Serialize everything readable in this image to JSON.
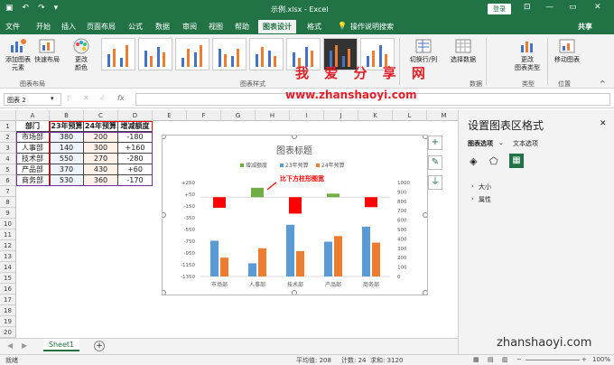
{
  "window": {
    "title": "示例.xlsx  -  Excel",
    "login_label": "登录",
    "share_label": "共享",
    "minimize": "—",
    "restore": "▭",
    "close": "✕"
  },
  "tabs": [
    "文件",
    "开始",
    "插入",
    "页面布局",
    "公式",
    "数据",
    "审阅",
    "视图",
    "帮助",
    "图表设计",
    "格式",
    "操作说明搜索"
  ],
  "ribbon": {
    "add_element": "添加图表\n元素",
    "quick_layout": "快速布局",
    "change_colors": "更改\n颜色",
    "switch_rowcol": "切换行/列",
    "select_data": "选择数据",
    "change_type": "更改\n图表类型",
    "move_chart": "移动图表",
    "groups": {
      "layout": "图表布局",
      "styles": "图表样式",
      "data": "数据",
      "type": "类型",
      "location": "位置"
    }
  },
  "watermark": {
    "site_cn": "我 爱 分 享 网",
    "url": "www.zhanshaoyi.com",
    "bottom_url": "zhanshaoyi.com"
  },
  "namebox": "图表 2",
  "fx": "fx",
  "columns": [
    "A",
    "B",
    "C",
    "D",
    "E",
    "F",
    "G",
    "H",
    "I",
    "J",
    "K",
    "L",
    "M"
  ],
  "rows": [
    "1",
    "2",
    "3",
    "4",
    "5",
    "6",
    "7",
    "8",
    "9",
    "10",
    "11",
    "12",
    "13",
    "14",
    "15",
    "16",
    "17",
    "18",
    "19",
    "20"
  ],
  "table": {
    "headers": [
      "部门",
      "23年预算",
      "24年预算",
      "增减额度"
    ],
    "rows": [
      [
        "市场部",
        "380",
        "200",
        "-180"
      ],
      [
        "人事部",
        "140",
        "300",
        "+160"
      ],
      [
        "技术部",
        "550",
        "270",
        "-280"
      ],
      [
        "产品部",
        "370",
        "430",
        "+60"
      ],
      [
        "商务部",
        "530",
        "360",
        "-170"
      ]
    ]
  },
  "chart_data": {
    "type": "bar",
    "title": "图表标题",
    "categories": [
      "市场部",
      "人事部",
      "技术部",
      "产品部",
      "商务部"
    ],
    "series": [
      {
        "name": "增减额度",
        "values": [
          -180,
          160,
          -280,
          60,
          -170
        ],
        "axis": "left",
        "colors": {
          "positive": "#70ad47",
          "negative": "#ff0000"
        }
      },
      {
        "name": "23年预算",
        "values": [
          380,
          140,
          550,
          370,
          530
        ],
        "axis": "right",
        "color": "#5b9bd5"
      },
      {
        "name": "24年预算",
        "values": [
          200,
          300,
          270,
          430,
          360
        ],
        "axis": "right",
        "color": "#ed7d31"
      }
    ],
    "left_ticks": [
      "+250",
      "+50",
      "-150",
      "-350",
      "-550",
      "-750",
      "-950",
      "-1150",
      "-1350"
    ],
    "left_ylim": [
      -1350,
      250
    ],
    "right_ticks": [
      "1000",
      "900",
      "800",
      "700",
      "600",
      "500",
      "400",
      "300",
      "200",
      "100",
      "0"
    ],
    "right_ylim": [
      0,
      1000
    ],
    "legend_position": "top",
    "annotation": "比下方柱形图宽"
  },
  "pane": {
    "title": "设置图表区格式",
    "tab1": "图表选项",
    "tab2": "文本选项",
    "sec1": "大小",
    "sec2": "属性",
    "close": "✕"
  },
  "sheet": {
    "name": "Sheet1",
    "add": "+"
  },
  "status": {
    "mode": "就绪",
    "avg": "平均值: 208",
    "count": "计数: 24",
    "sum": "求和: 3120",
    "zoom": "100%"
  }
}
